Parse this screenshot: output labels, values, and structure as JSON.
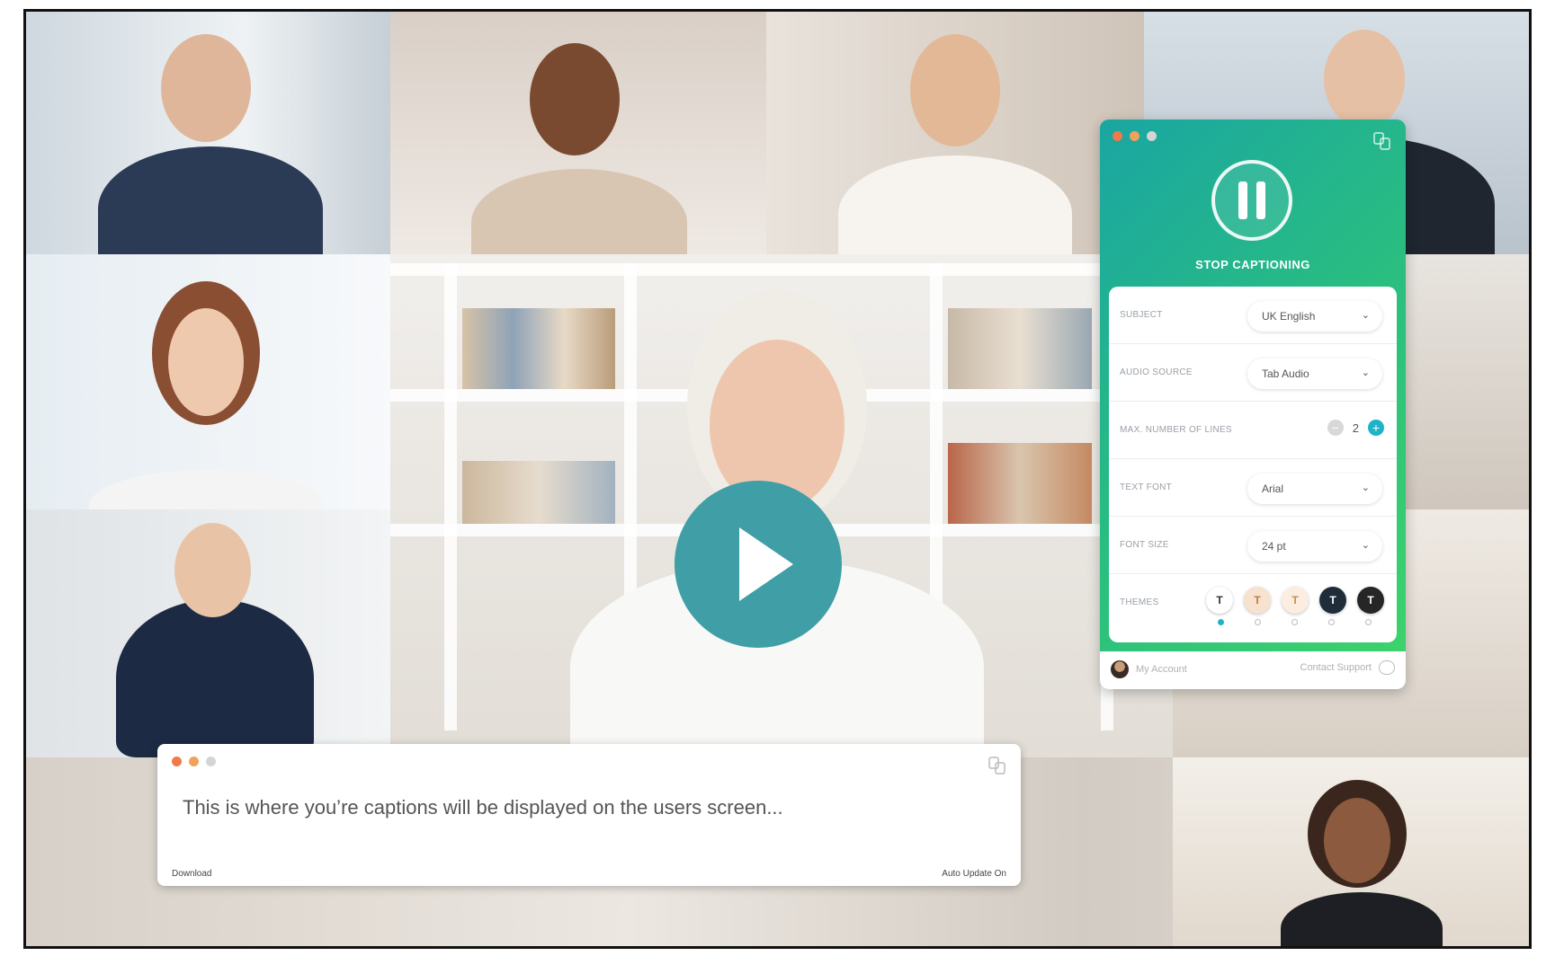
{
  "panel": {
    "stop_label": "STOP CAPTIONING",
    "settings": [
      {
        "label": "SUBJECT",
        "value": "UK English"
      },
      {
        "label": "AUDIO SOURCE",
        "value": "Tab Audio"
      },
      {
        "label": "MAX. NUMBER OF LINES",
        "value": "2"
      },
      {
        "label": "TEXT FONT",
        "value": "Arial"
      },
      {
        "label": "FONT SIZE",
        "value": "24 pt"
      },
      {
        "label": "THEMES",
        "value": ""
      }
    ],
    "themes": [
      {
        "glyph": "T",
        "bg": "#ffffff",
        "fg": "#333333"
      },
      {
        "glyph": "T",
        "bg": "#f6e2cf",
        "fg": "#c07a3e"
      },
      {
        "glyph": "T",
        "bg": "#fbeee0",
        "fg": "#c98b4e"
      },
      {
        "glyph": "T",
        "bg": "#1f2d3a",
        "fg": "#ffffff"
      },
      {
        "glyph": "T",
        "bg": "#262626",
        "fg": "#ffffff"
      }
    ],
    "selected_theme": 0,
    "chevron": "⌄",
    "minus": "−",
    "plus": "+",
    "account": "My Account",
    "support": "Contact Support",
    "accent": "#1fb3c9"
  },
  "caption": {
    "text": "This is where you’re captions will be displayed on the users screen...",
    "left_link": "Download",
    "right_link": "Auto Update On"
  },
  "window_dots": [
    "#f07a4a",
    "#f0a25a",
    "#d5d5d5"
  ],
  "icons": {
    "play": "play-icon",
    "pause": "pause-icon",
    "logo": "app-logo-icon",
    "chat": "chat-bubble-icon"
  }
}
